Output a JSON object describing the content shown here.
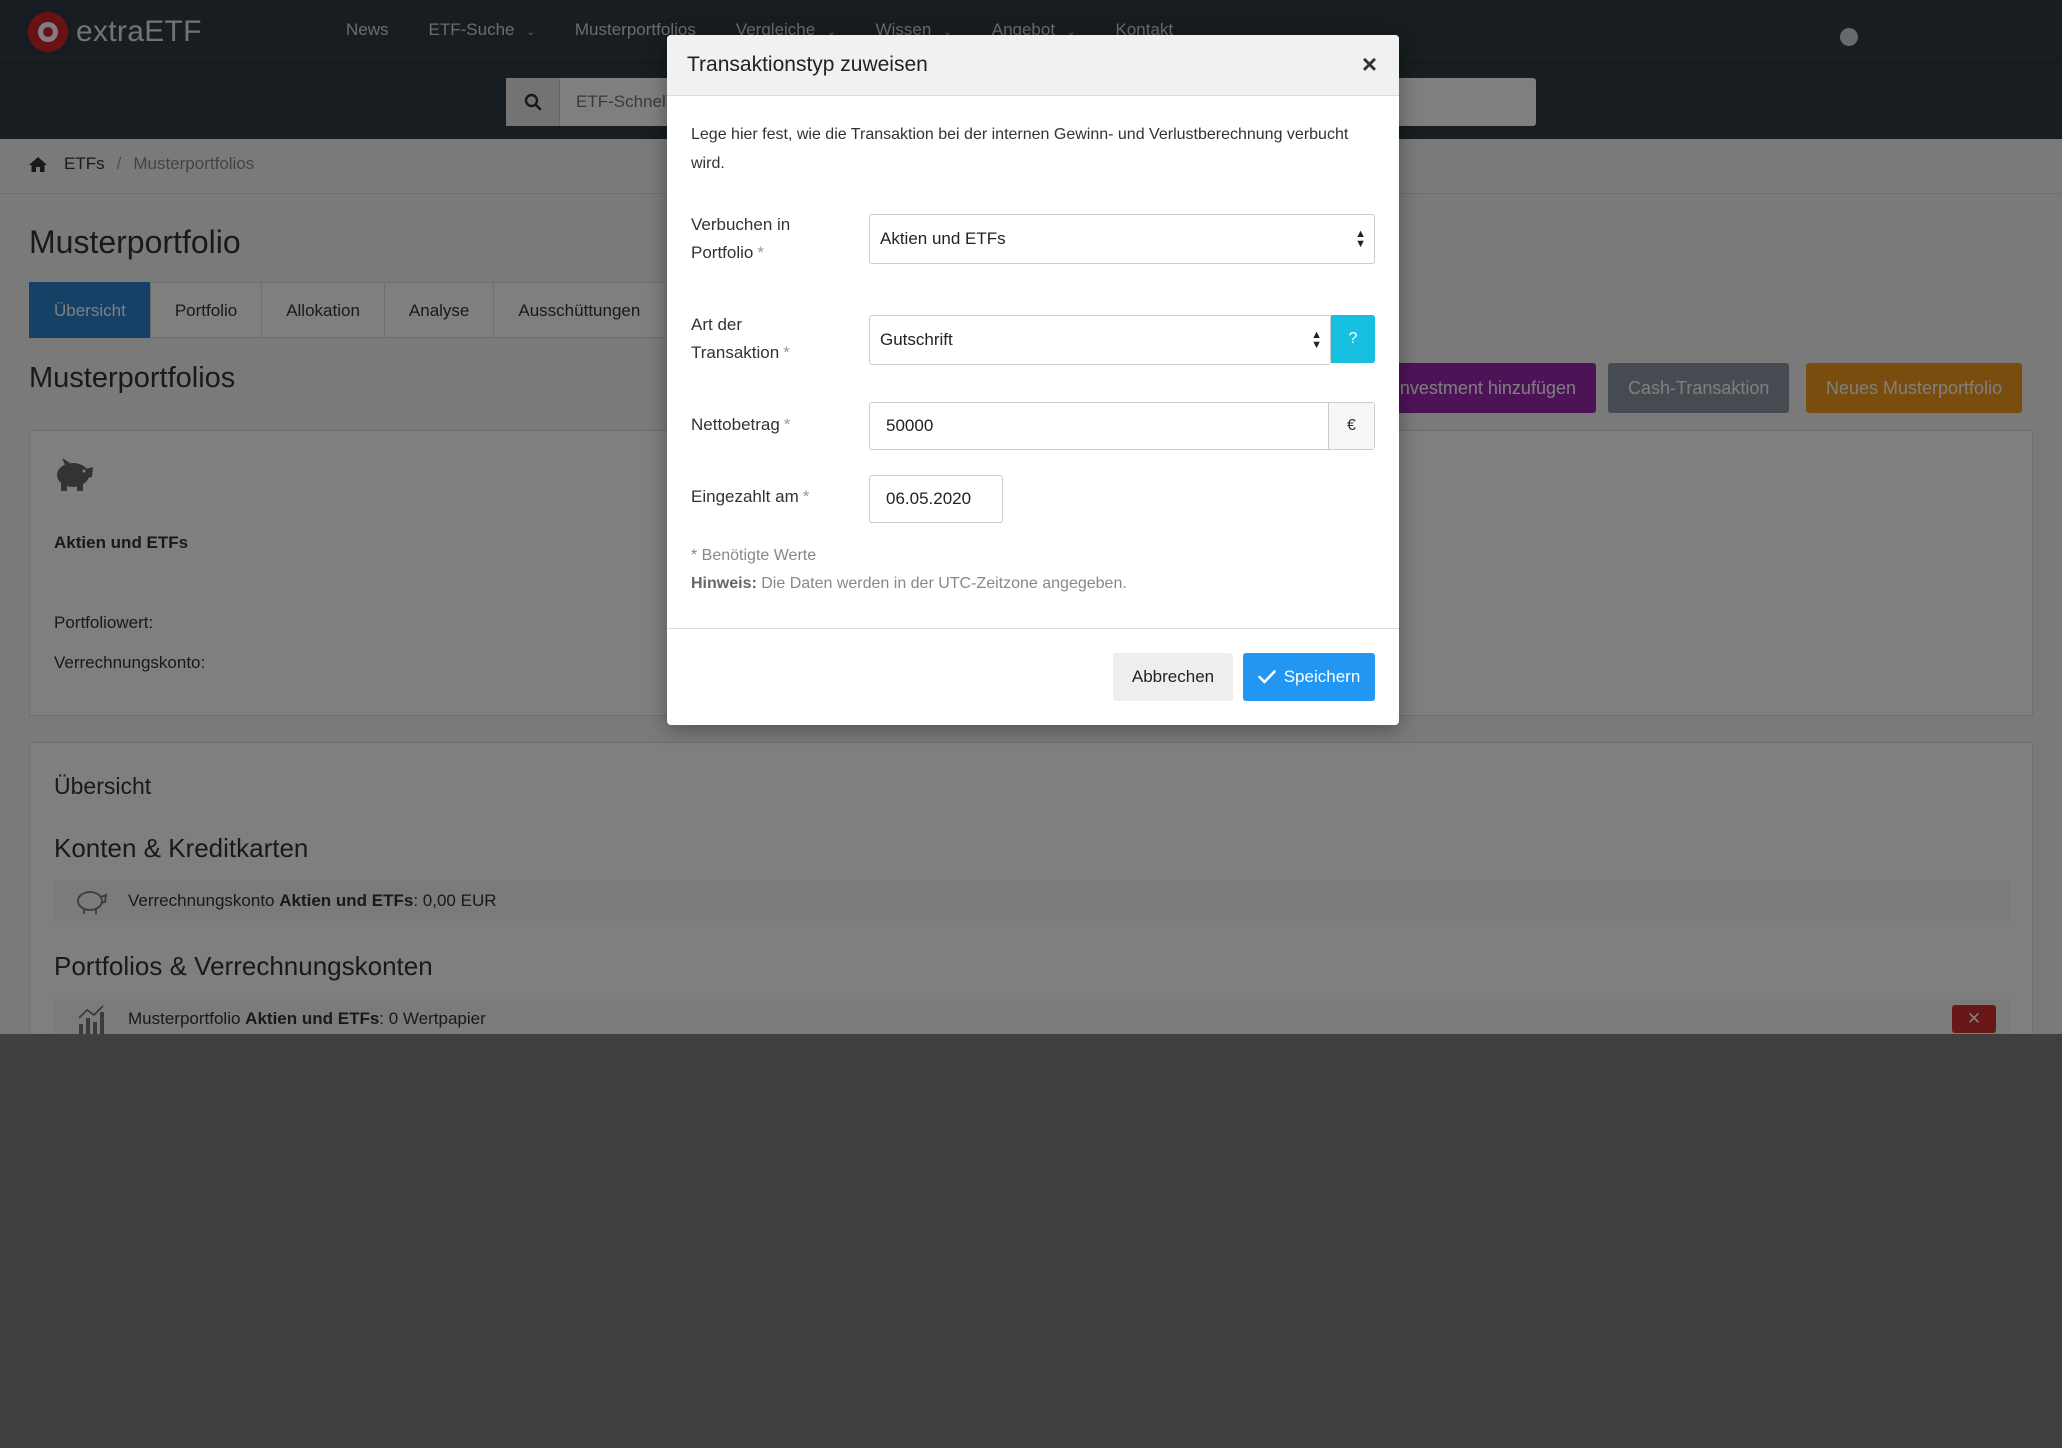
{
  "brand": {
    "name": "extraETF"
  },
  "nav": {
    "items": [
      {
        "label": "News",
        "dropdown": false
      },
      {
        "label": "ETF-Suche",
        "dropdown": true
      },
      {
        "label": "Musterportfolios",
        "dropdown": false
      },
      {
        "label": "Vergleiche",
        "dropdown": true
      },
      {
        "label": "Wissen",
        "dropdown": true
      },
      {
        "label": "Angebot",
        "dropdown": true
      },
      {
        "label": "Kontakt",
        "dropdown": false
      }
    ],
    "user_icon": "user-circle-icon"
  },
  "search": {
    "placeholder": "ETF-Schnellsuche"
  },
  "breadcrumb": {
    "home_icon": "home-icon",
    "items": [
      "ETFs",
      "Musterportfolios"
    ]
  },
  "page": {
    "title": "Musterportfolio"
  },
  "tabs": [
    {
      "label": "Übersicht",
      "active": true
    },
    {
      "label": "Portfolio",
      "active": false
    },
    {
      "label": "Allokation",
      "active": false
    },
    {
      "label": "Analyse",
      "active": false
    },
    {
      "label": "Ausschüttungen",
      "active": false
    }
  ],
  "section": {
    "title": "Musterportfolios"
  },
  "actions": {
    "add_investment": "Investment hinzufügen",
    "cash_transaction": "Cash-Transaktion",
    "new_portfolio": "Neues Musterportfolio"
  },
  "portfolio_card": {
    "icon": "piggy-bank-icon",
    "name": "Aktien und ETFs",
    "portfolio_value_label": "Portfoliowert:",
    "account_label": "Verrechnungskonto:"
  },
  "overview": {
    "title": "Übersicht",
    "accounts_heading": "Konten & Kreditkarten",
    "account_row": {
      "prefix": "Verrechnungskonto ",
      "name": "Aktien und ETFs",
      "suffix": ": 0,00 EUR"
    },
    "portfolios_heading": "Portfolios & Verrechnungskonten",
    "portfolio_row": {
      "prefix": "Musterportfolio ",
      "name": "Aktien und ETFs",
      "suffix": ": 0 Wertpapier"
    }
  },
  "modal": {
    "title": "Transaktionstyp zuweisen",
    "close": "×",
    "description": "Lege hier fest, wie die Transaktion bei der internen Gewinn- und Verlustberechnung verbucht wird.",
    "fields": {
      "portfolio": {
        "label_line1": "Verbuchen in",
        "label_line2": "Portfolio",
        "value": "Aktien und ETFs"
      },
      "type": {
        "label_line1": "Art der",
        "label_line2": "Transaktion",
        "value": "Gutschrift",
        "help": "?"
      },
      "amount": {
        "label": "Nettobetrag",
        "value": "50000",
        "currency": "€"
      },
      "date": {
        "label": "Eingezahlt am",
        "value": "06.05.2020"
      }
    },
    "required_marker": "*",
    "required_note": "* Benötigte Werte",
    "hint_label": "Hinweis:",
    "hint_text": " Die Daten werden in der UTC-Zeitzone angegeben.",
    "cancel": "Abbrechen",
    "save": "Speichern"
  },
  "colors": {
    "navbar": "#2f3a40",
    "tab_active": "#2b82cf",
    "purple": "#9b27af",
    "gray": "#8a96a0",
    "orange": "#f09a1a",
    "save": "#2196f3",
    "help": "#17c0e0",
    "danger": "#d32f2f"
  }
}
